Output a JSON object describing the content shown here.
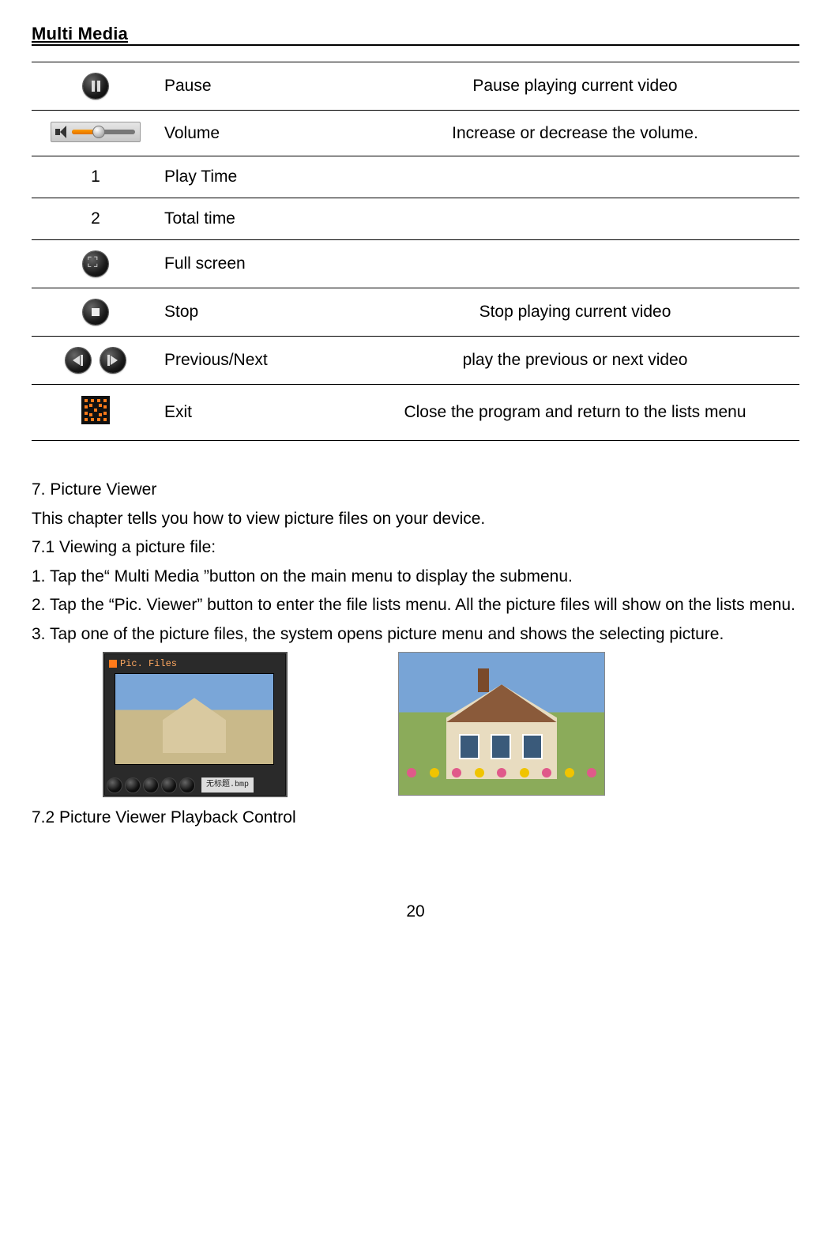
{
  "header": {
    "title": "Multi Media"
  },
  "table": {
    "rows": [
      {
        "icon": "pause-icon",
        "name": "Pause",
        "desc": "Pause playing current video"
      },
      {
        "icon": "volume-slider-icon",
        "name": "Volume",
        "desc": "Increase or decrease the volume."
      },
      {
        "icon": "number-one",
        "icon_text": "1",
        "name": "Play Time",
        "desc": ""
      },
      {
        "icon": "number-two",
        "icon_text": "2",
        "name": "Total time",
        "desc": ""
      },
      {
        "icon": "fullscreen-icon",
        "name": "Full screen",
        "desc": ""
      },
      {
        "icon": "stop-icon",
        "name": "Stop",
        "desc": "Stop playing current video"
      },
      {
        "icon": "prev-next-icons",
        "name": "Previous/Next",
        "desc": "play the previous or next video"
      },
      {
        "icon": "exit-icon",
        "name": "Exit",
        "desc": "Close the program and return to the lists menu"
      }
    ]
  },
  "section7": {
    "title": "7. Picture Viewer",
    "intro": "This chapter tells you how to view picture files on your device.",
    "sub71": "7.1 Viewing a picture file:",
    "step1": "1. Tap the“ Multi Media ”button on the main menu to display the submenu.",
    "step2": "2. Tap the “Pic. Viewer”  button to enter the file lists menu. All the picture files will show on the lists menu.",
    "step3": "3. Tap one of the picture files, the system opens picture menu and shows the selecting picture.",
    "fig_a_title": "Pic. Files",
    "fig_a_filename": "无标题.bmp",
    "sub72": "7.2 Picture Viewer Playback Control"
  },
  "page_number": "20"
}
